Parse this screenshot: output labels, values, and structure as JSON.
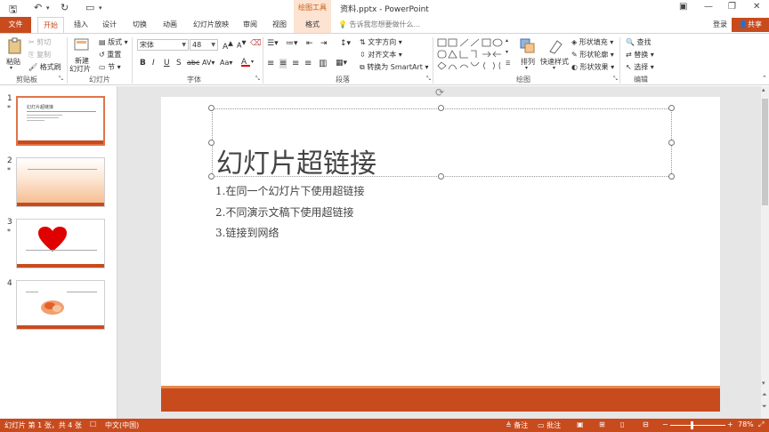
{
  "app": {
    "title": "资料.pptx - PowerPoint",
    "context_band": "绘图工具"
  },
  "tabs": {
    "file": "文件",
    "items": [
      "开始",
      "插入",
      "设计",
      "切换",
      "动画",
      "幻灯片放映",
      "审阅",
      "视图"
    ],
    "context": "格式",
    "tell_me": "告诉我您想要做什么...",
    "sign_in": "登录",
    "share": "共享"
  },
  "ribbon": {
    "clipboard": {
      "paste": "粘贴",
      "cut": "剪切",
      "copy": "复制",
      "format_painter": "格式刷",
      "label": "剪贴板"
    },
    "slides": {
      "new_slide": "新建",
      "new_slide2": "幻灯片",
      "layout": "版式",
      "reset": "重置",
      "section": "节",
      "label": "幻灯片"
    },
    "font": {
      "name": "宋体",
      "size": "48",
      "label": "字体"
    },
    "paragraph": {
      "text_direction": "文字方向",
      "align_text": "对齐文本",
      "smartart": "转换为 SmartArt",
      "label": "段落"
    },
    "drawing": {
      "arrange": "排列",
      "quick_styles": "快速样式",
      "shape_fill": "形状填充",
      "shape_outline": "形状轮廓",
      "shape_effects": "形状效果",
      "label": "绘图"
    },
    "editing": {
      "find": "查找",
      "replace": "替换",
      "select": "选择",
      "label": "编辑"
    }
  },
  "thumbnails": [
    {
      "num": "1",
      "star": "*",
      "mini_title": "幻灯片超链接"
    },
    {
      "num": "2",
      "star": "*"
    },
    {
      "num": "3",
      "star": "*"
    },
    {
      "num": "4"
    }
  ],
  "slide": {
    "title": "幻灯片超链接",
    "bullets": [
      "1.在同一个幻灯片下使用超链接",
      "2.不同演示文稿下使用超链接",
      "3.链接到网络"
    ]
  },
  "status": {
    "slide_info": "幻灯片 第 1 张，共 4 张",
    "language": "中文(中国)",
    "notes": "备注",
    "comments": "批注",
    "zoom": "78%"
  },
  "colors": {
    "accent": "#c84b1e",
    "accent_light": "#e58a4b",
    "context_band": "#fde3d2"
  }
}
